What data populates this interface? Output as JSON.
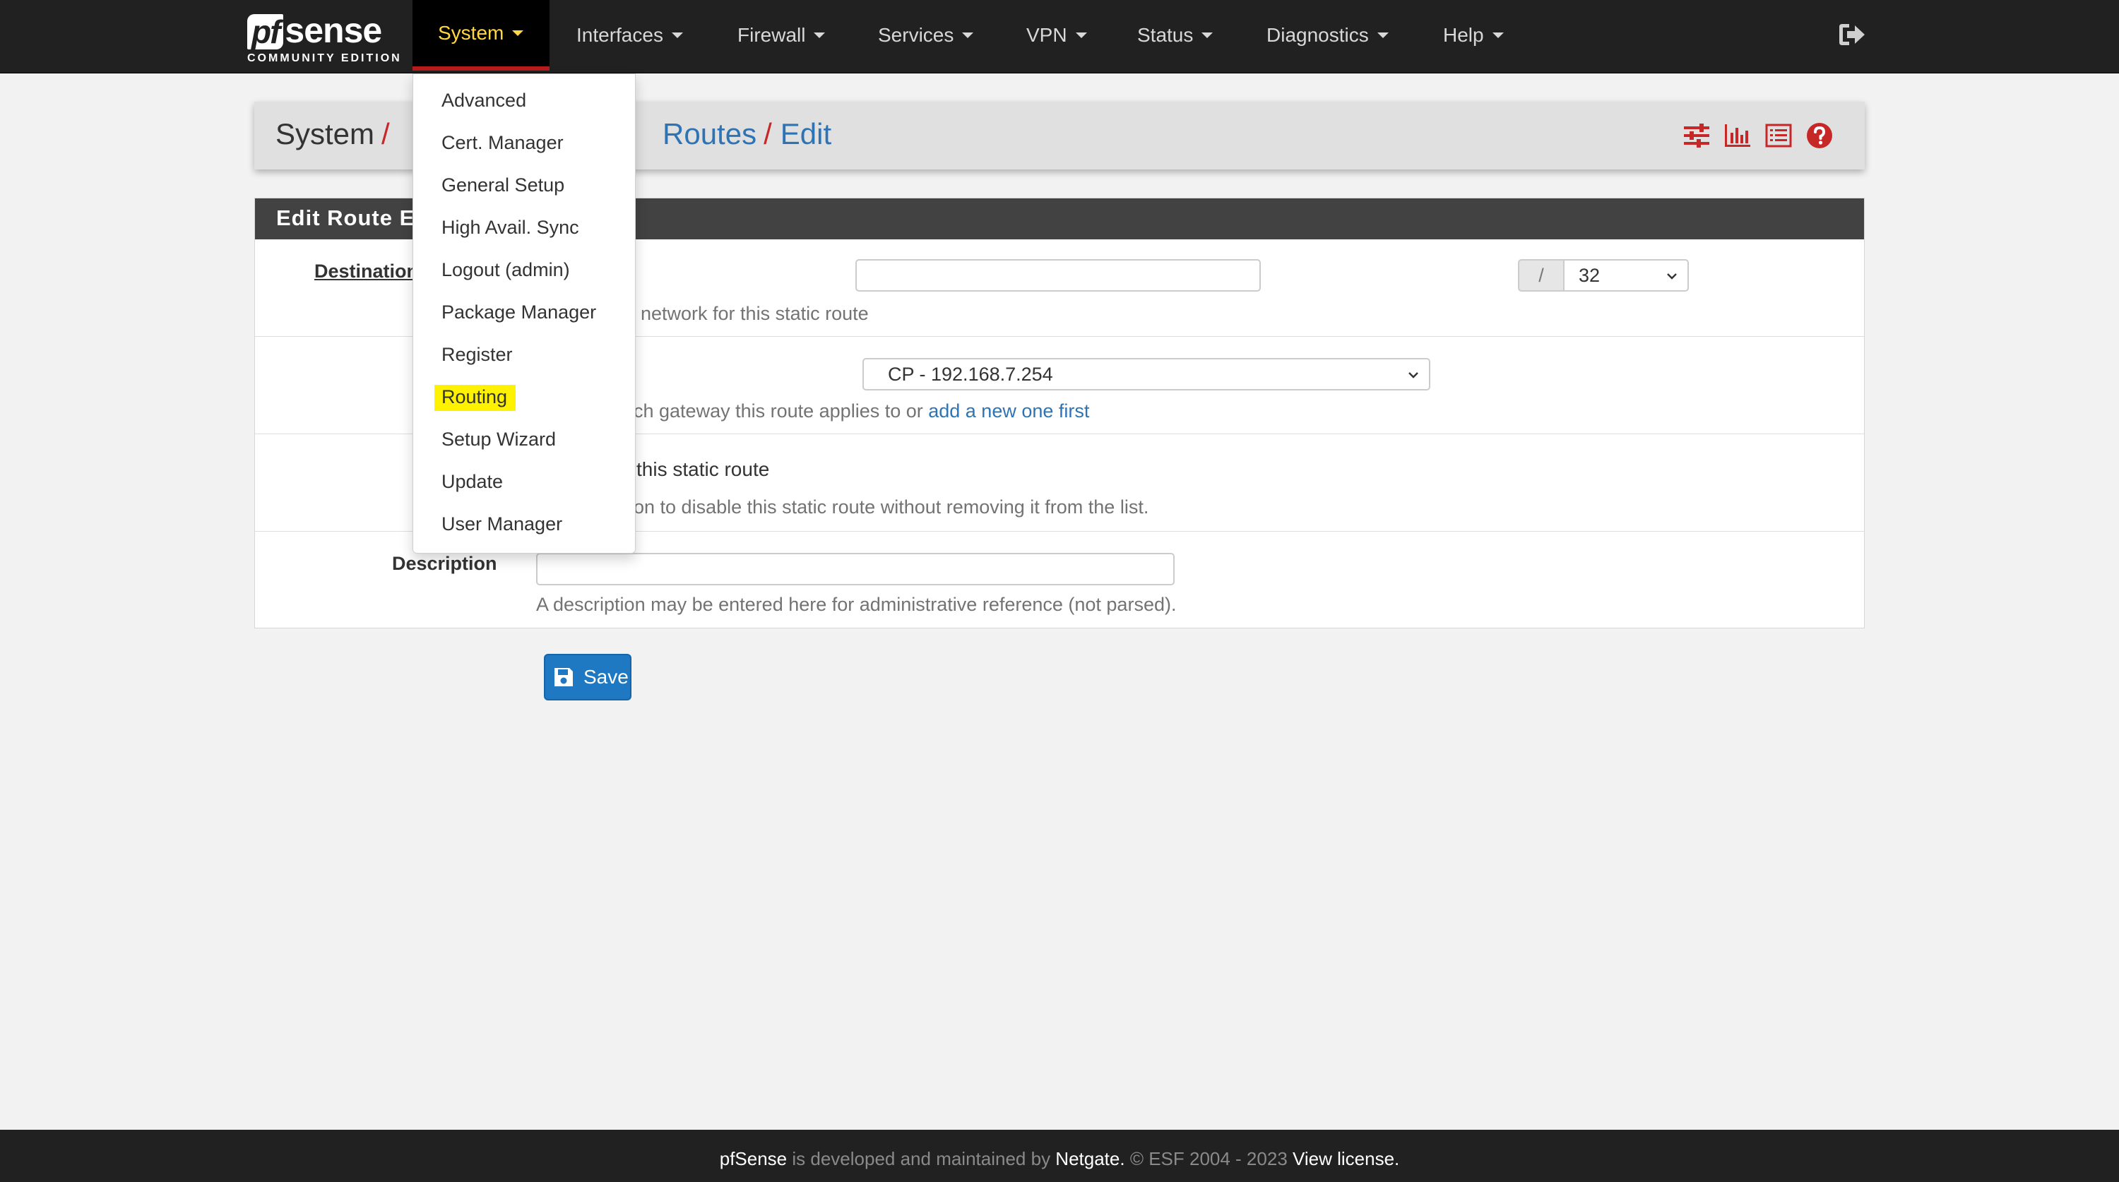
{
  "brand": {
    "logo_prefix": "pf",
    "logo_suffix": "sense",
    "edition": "COMMUNITY EDITION"
  },
  "navbar": {
    "items": [
      {
        "label": "System",
        "active": true
      },
      {
        "label": "Interfaces"
      },
      {
        "label": "Firewall"
      },
      {
        "label": "Services"
      },
      {
        "label": "VPN"
      },
      {
        "label": "Status"
      },
      {
        "label": "Diagnostics"
      },
      {
        "label": "Help"
      }
    ],
    "logout_icon": "sign-out-icon"
  },
  "breadcrumb": {
    "system": "System",
    "sep": "/",
    "routes": "Routes",
    "edit": "Edit",
    "tools": [
      "sliders-icon",
      "bar-chart-icon",
      "list-icon",
      "question-circle-icon"
    ]
  },
  "system_menu": {
    "items": [
      "Advanced",
      "Cert. Manager",
      "General Setup",
      "High Avail. Sync",
      "Logout (admin)",
      "Package Manager",
      "Register",
      "Routing",
      "Setup Wizard",
      "Update",
      "User Manager"
    ],
    "highlighted": "Routing"
  },
  "form": {
    "heading": "Edit Route E",
    "destination": {
      "label": "Destination",
      "value": "",
      "help": "network for this static route",
      "mask_sep": "/",
      "mask_value": "32"
    },
    "gateway": {
      "selected": "CP - 192.168.7.254",
      "help_prefix": "ich gateway this route applies to or ",
      "help_link": "add a new one first"
    },
    "disabled": {
      "label": "this static route",
      "help": "ion to disable this static route without removing it from the list."
    },
    "description": {
      "label": "Description",
      "value": "",
      "help": "A description may be entered here for administrative reference (not parsed)."
    }
  },
  "save_button": {
    "label": "Save",
    "icon": "save-icon"
  },
  "footer": {
    "brand": "pfSense",
    "text1": " is developed and maintained by ",
    "company": "Netgate.",
    "text2": " © ESF 2004 - 2023 ",
    "license": "View license."
  },
  "colors": {
    "navbar_bg": "#212121",
    "active_nav": "#ffd740",
    "accent_red": "#b71c1c",
    "link_blue": "#2e74b5",
    "save_blue": "#1e78c2",
    "highlight_yellow": "#fff200"
  }
}
